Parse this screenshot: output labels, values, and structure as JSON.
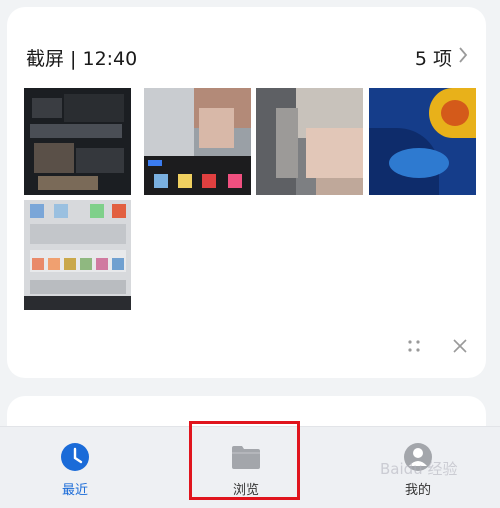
{
  "card": {
    "title": "截屏 | 12:40",
    "count": "5 项",
    "thumbnails": [
      {
        "name": "screenshot-thumb-1"
      },
      {
        "name": "screenshot-thumb-2"
      },
      {
        "name": "screenshot-thumb-3"
      },
      {
        "name": "screenshot-thumb-4"
      },
      {
        "name": "screenshot-thumb-5"
      }
    ]
  },
  "tabs": [
    {
      "label": "最近",
      "icon": "clock-icon",
      "active": true
    },
    {
      "label": "浏览",
      "icon": "folder-icon",
      "active": false
    },
    {
      "label": "我的",
      "icon": "avatar-icon",
      "active": false
    }
  ],
  "watermark": "Baidu 经验",
  "colors": {
    "accent": "#1a6bd8",
    "highlight": "#e0141d",
    "background": "#f1f3f5"
  }
}
